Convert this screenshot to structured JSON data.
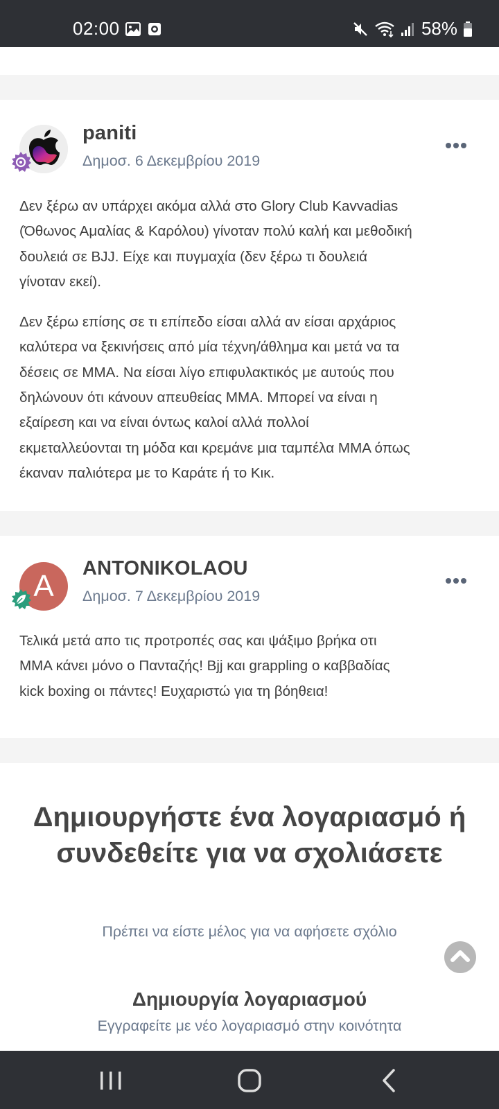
{
  "status_bar": {
    "time": "02:00",
    "battery": "58%",
    "icons": [
      "image-icon",
      "screen-record-icon",
      "mute-icon",
      "wifi-icon",
      "signal-icon",
      "battery-icon"
    ]
  },
  "posts": [
    {
      "author": "paniti",
      "date": "Δημοσ. 6 Δεκεμβρίου 2019",
      "avatar": "apple-logo-avatar",
      "badge": "gear-badge-icon",
      "paragraphs": [
        "Δεν ξέρω αν υπάρχει ακόμα αλλά στο Glory Club Kavvadias\n(Όθωνος Αμαλίας & Καρόλου) γίνοταν πολύ καλή και μεθοδική\nδουλειά σε BJJ. Είχε και πυγμαχία (δεν ξέρω τι δουλειά\nγίνοταν εκεί).",
        "Δεν ξέρω επίσης σε τι επίπεδο είσαι αλλά αν είσαι αρχάριος\nκαλύτερα να ξεκινήσεις από μία τέχνη/άθλημα και μετά να τα\nδέσεις σε MMA. Να είσαι λίγο επιφυλακτικός με αυτούς που\nδηλώνουν ότι κάνουν απευθείας MMA. Μπορεί να είναι η\nεξαίρεση και να είναι όντως καλοί αλλά πολλοί\nεκμεταλλεύονται τη μόδα και κρεμάνε μια ταμπέλα MMA όπως\nέκαναν παλιότερα με το Καράτε ή το Κικ."
      ]
    },
    {
      "author": "ANTONIKOLAOU",
      "date": "Δημοσ. 7 Δεκεμβρίου 2019",
      "avatar_letter": "A",
      "avatar_color": "#c9675d",
      "badge": "leaf-badge-icon",
      "paragraphs": [
        "Τελικά μετά απο τις προτροπές σας και ψάξιμο βρήκα οτι\nMMA  κάνει μόνο ο Πανταζής! Bjj και grappling ο καββαδίας\nkick boxing οι πάντες! Ευχαριστώ για τη βόηθεια!"
      ]
    }
  ],
  "login_prompt": {
    "title": "Δημιουργήστε ένα λογαριασμό ή συνδεθείτε για να σχολιάσετε",
    "subtitle": "Πρέπει να είστε μέλος για να αφήσετε σχόλιο",
    "create_title": "Δημιουργία λογαριασμού",
    "create_subtitle": "Εγγραφείτε με νέο λογαριασμό στην κοινότητα"
  },
  "colors": {
    "bar_bg": "#2e3035",
    "gap_bg": "#f4f4f4",
    "meta_text": "#6c7a8e",
    "body_text": "#3e3e3e"
  },
  "nav_bar": {
    "buttons": [
      "recent-apps-icon",
      "home-icon",
      "back-icon"
    ]
  }
}
